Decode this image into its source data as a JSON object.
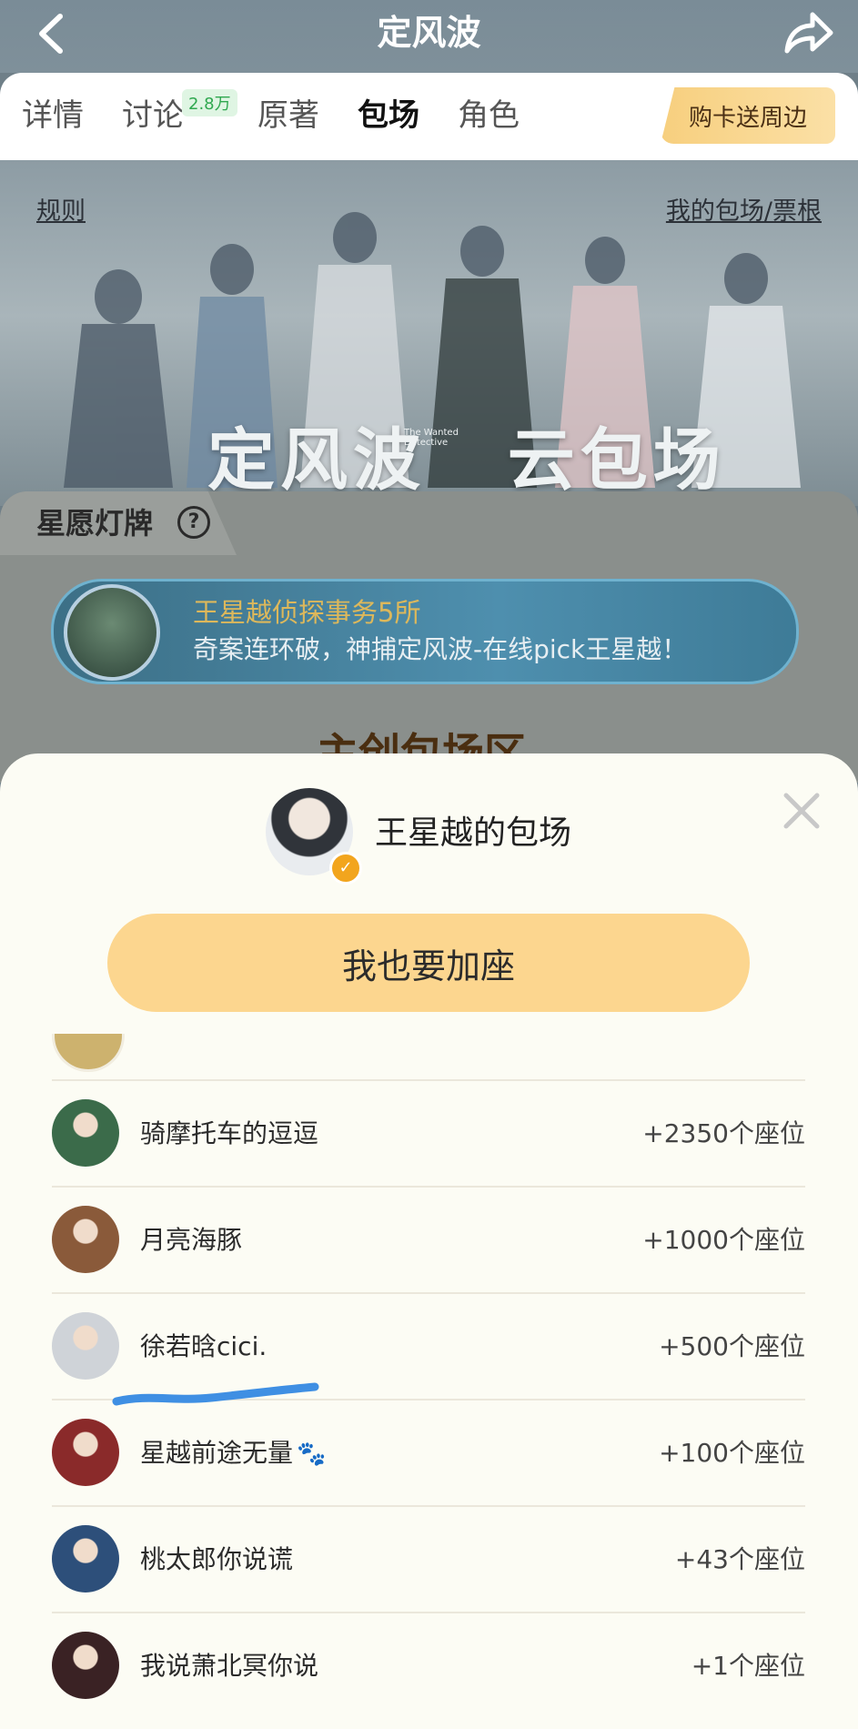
{
  "header": {
    "title": "定风波",
    "back_icon": "chevron-left-icon",
    "share_icon": "share-icon"
  },
  "tabs": [
    {
      "label": "详情"
    },
    {
      "label": "讨论",
      "badge": "2.8万"
    },
    {
      "label": "原著"
    },
    {
      "label": "包场",
      "active": true
    },
    {
      "label": "角色"
    }
  ],
  "promo_button": "购卡送周边",
  "banner": {
    "rules_link": "规则",
    "my_link": "我的包场/票根",
    "title": "定风波",
    "subtitle": "The Wanted Detective",
    "subtitle2": "云包场"
  },
  "lamp": {
    "title": "星愿灯牌",
    "help_icon": "question-circle-icon",
    "line1": "王星越侦探事务5所",
    "line2": "奇案连环破，神捕定风波-在线pick王星越！",
    "section_peek": "主创包场区"
  },
  "sheet": {
    "title": "王星越的包场",
    "join_button": "我也要加座",
    "close_icon": "close-icon",
    "verified_icon": "verified-check-icon",
    "rows": [
      {
        "name": "骑摩托车的逗逗",
        "seats": "+2350个座位",
        "avatar_color": "#3b6b4a"
      },
      {
        "name": "月亮海豚",
        "seats": "+1000个座位",
        "avatar_color": "#8a5a3a"
      },
      {
        "name": "徐若晗cici.",
        "seats": "+500个座位",
        "avatar_color": "#cfd3d8"
      },
      {
        "name": "星越前途无量",
        "seats": "+100个座位",
        "avatar_color": "#8a2a2a",
        "emoji": "🐾"
      },
      {
        "name": "桃太郎你说谎",
        "seats": "+43个座位",
        "avatar_color": "#2d4f7a"
      },
      {
        "name": "我说萧北冥你说",
        "seats": "+1个座位",
        "avatar_color": "#3a2224"
      }
    ]
  },
  "colors": {
    "accent_button": "#fcd68f",
    "lamp_gold": "#ddb85b",
    "badge_green": "#2fa84f",
    "underline_blue": "#3f8fe3"
  }
}
